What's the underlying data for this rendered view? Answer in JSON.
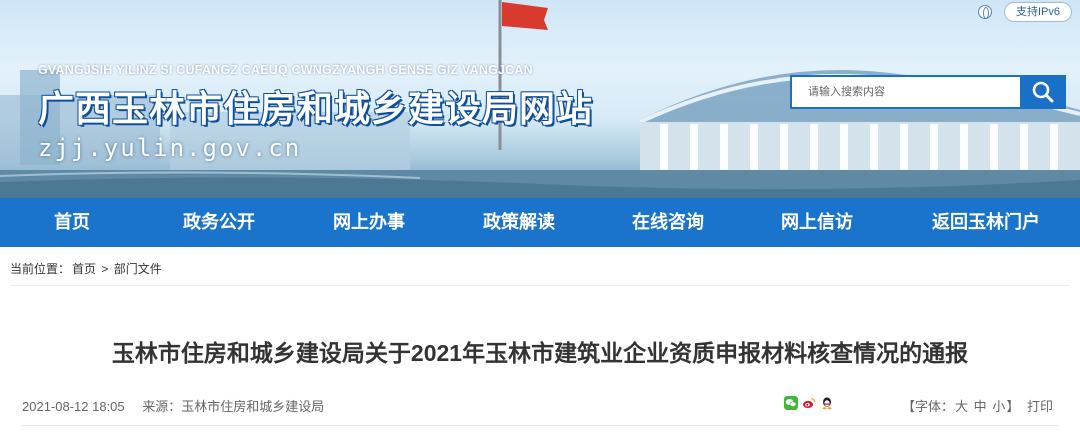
{
  "header": {
    "ipv6_label": "支持IPv6",
    "pinyin": "GVANGJSIH YILINZ SI CUFANGZ CAEUQ CWNGZYANGH GENSE GIZ VANGJCAN",
    "site_title": "广西玉林市住房和城乡建设局网站",
    "domain": "zjj.yulin.gov.cn",
    "search": {
      "placeholder": "请输入搜索内容",
      "value": ""
    },
    "icons": {
      "ipv6": "globe-icon",
      "search": "search-icon"
    }
  },
  "nav": {
    "items": [
      {
        "label": "首页"
      },
      {
        "label": "政务公开"
      },
      {
        "label": "网上办事"
      },
      {
        "label": "政策解读"
      },
      {
        "label": "在线咨询"
      },
      {
        "label": "网上信访"
      },
      {
        "label": "返回玉林门户"
      }
    ]
  },
  "breadcrumb": {
    "prefix": "当前位置：",
    "home": "首页",
    "separator": ">",
    "current": "部门文件"
  },
  "article": {
    "title": "玉林市住房和城乡建设局关于2021年玉林市建筑业企业资质申报材料核查情况的通报",
    "datetime": "2021-08-12 18:05",
    "source": "来源：玉林市住房和城乡建设局",
    "share_icons": [
      "wechat-icon",
      "weibo-icon",
      "qq-icon"
    ],
    "fontsize": {
      "prefix": "【字体：",
      "large": "大",
      "medium": "中",
      "small": "小",
      "suffix": "】"
    },
    "print_label": "打印"
  },
  "colors": {
    "nav_bg": "#1b74cc",
    "search_accent": "#1a6fc6",
    "title_text": "#333333",
    "meta_text": "#666666"
  }
}
